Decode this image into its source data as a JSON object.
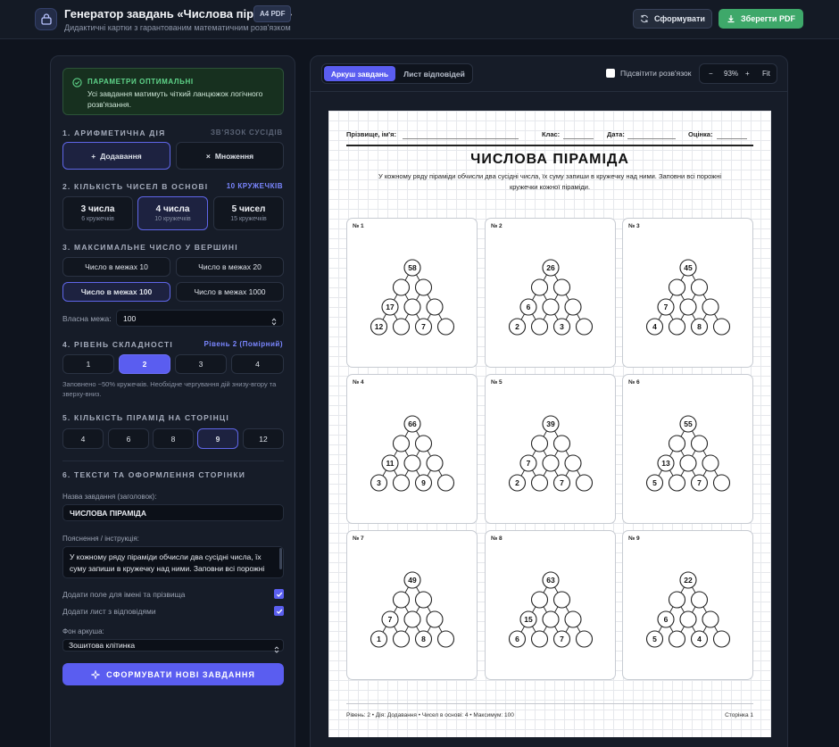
{
  "header": {
    "title": "Генератор завдань «Числова піраміда»",
    "badge": "A4 PDF",
    "subtitle": "Дидактичні картки з гарантованим математичним розв'язком",
    "generate_label": "Сформувати",
    "save_pdf_label": "Зберегти PDF"
  },
  "status": {
    "title": "ПАРАМЕТРИ ОПТИМАЛЬНІ",
    "text": "Усі завдання матимуть чіткий ланцюжок логічного розв'язання."
  },
  "operation": {
    "heading": "1. АРИФМЕТИЧНА ДІЯ",
    "side_label": "ЗВ'ЯЗОК СУСІДІВ",
    "options": [
      {
        "label": "Додавання",
        "symbol": "+",
        "selected": true
      },
      {
        "label": "Множення",
        "symbol": "×",
        "selected": false
      }
    ]
  },
  "base_count": {
    "heading": "2. КІЛЬКІСТЬ ЧИСЕЛ В ОСНОВІ",
    "side_label": "10 КРУЖЕЧКІВ",
    "options": [
      {
        "title": "3 числа",
        "sub": "6 кружечків",
        "selected": false
      },
      {
        "title": "4 числа",
        "sub": "10 кружечків",
        "selected": true
      },
      {
        "title": "5 чисел",
        "sub": "15 кружечків",
        "selected": false
      }
    ]
  },
  "max_top": {
    "heading": "3. МАКСИМАЛЬНЕ ЧИСЛО У ВЕРШИНІ",
    "options": [
      {
        "label": "Число в межах 10",
        "selected": false
      },
      {
        "label": "Число в межах 20",
        "selected": false
      },
      {
        "label": "Число в межах 100",
        "selected": true
      },
      {
        "label": "Число в межах 1000",
        "selected": false
      }
    ],
    "custom_label": "Власна межа:",
    "custom_value": "100"
  },
  "difficulty": {
    "heading": "4. РІВЕНЬ СКЛАДНОСТІ",
    "side_label": "Рівень 2 (Помірний)",
    "options": [
      {
        "label": "1",
        "selected": false
      },
      {
        "label": "2",
        "selected": true
      },
      {
        "label": "3",
        "selected": false
      },
      {
        "label": "4",
        "selected": false
      }
    ],
    "hint": "Заповнено ~50% кружечків. Необхідне чергування дій знизу-вгору та зверху-вниз."
  },
  "per_page": {
    "heading": "5. КІЛЬКІСТЬ ПІРАМІД НА СТОРІНЦІ",
    "options": [
      {
        "label": "4",
        "selected": false
      },
      {
        "label": "6",
        "selected": false
      },
      {
        "label": "8",
        "selected": false
      },
      {
        "label": "9",
        "selected": true
      },
      {
        "label": "12",
        "selected": false
      }
    ]
  },
  "texts": {
    "heading": "6. ТЕКСТИ ТА ОФОРМЛЕННЯ СТОРІНКИ",
    "title_label": "Назва завдання (заголовок):",
    "title_value": "ЧИСЛОВА ПІРАМІДА",
    "instr_label": "Пояснення / інструкція:",
    "instr_value": "У кожному ряду піраміди обчисли два сусідні числа, їх суму запиши в кружечку над ними. Заповни всі порожні кружечки кожної піраміди.",
    "name_field_label": "Додати поле для імені та прізвища",
    "answers_label": "Додати лист з відповідями",
    "bg_label": "Фон аркуша:",
    "bg_value": "Зошитова клітинка",
    "submit_label": "СФОРМУВАТИ НОВІ ЗАВДАННЯ"
  },
  "preview": {
    "tab_sheet": "Аркуш завдань",
    "tab_answers": "Лист відповідей",
    "highlight_label": "Підсвітити розв'язок",
    "zoom_minus": "−",
    "zoom_value": "93%",
    "zoom_plus": "+",
    "zoom_fit": "Fit"
  },
  "sheet": {
    "name_label": "Прізвище, ім'я:",
    "class_label": "Клас:",
    "date_label": "Дата:",
    "grade_label": "Оцінка:",
    "title": "ЧИСЛОВА ПІРАМІДА",
    "instruction": "У кожному ряду піраміди обчисли два сусідні числа, їх суму запиши в кружечку над ними. Заповни всі порожні кружечки кожної піраміди.",
    "footer_left": "Рівень: 2 • Дія: Додавання • Чисел в основі: 4 • Максимум: 100",
    "footer_right": "Сторінка 1",
    "pyramids": [
      {
        "num": "№ 1",
        "rows": [
          [
            "58"
          ],
          [
            "",
            ""
          ],
          [
            "17",
            "",
            ""
          ],
          [
            "12",
            "",
            "7",
            ""
          ]
        ]
      },
      {
        "num": "№ 2",
        "rows": [
          [
            "26"
          ],
          [
            "",
            ""
          ],
          [
            "6",
            "",
            ""
          ],
          [
            "2",
            "",
            "3",
            ""
          ]
        ]
      },
      {
        "num": "№ 3",
        "rows": [
          [
            "45"
          ],
          [
            "",
            ""
          ],
          [
            "7",
            "",
            ""
          ],
          [
            "4",
            "",
            "8",
            ""
          ]
        ]
      },
      {
        "num": "№ 4",
        "rows": [
          [
            "66"
          ],
          [
            "",
            ""
          ],
          [
            "11",
            "",
            ""
          ],
          [
            "3",
            "",
            "9",
            ""
          ]
        ]
      },
      {
        "num": "№ 5",
        "rows": [
          [
            "39"
          ],
          [
            "",
            ""
          ],
          [
            "7",
            "",
            ""
          ],
          [
            "2",
            "",
            "7",
            ""
          ]
        ]
      },
      {
        "num": "№ 6",
        "rows": [
          [
            "55"
          ],
          [
            "",
            ""
          ],
          [
            "13",
            "",
            ""
          ],
          [
            "5",
            "",
            "7",
            ""
          ]
        ]
      },
      {
        "num": "№ 7",
        "rows": [
          [
            "49"
          ],
          [
            "",
            ""
          ],
          [
            "7",
            "",
            ""
          ],
          [
            "1",
            "",
            "8",
            ""
          ]
        ]
      },
      {
        "num": "№ 8",
        "rows": [
          [
            "63"
          ],
          [
            "",
            ""
          ],
          [
            "15",
            "",
            ""
          ],
          [
            "6",
            "",
            "7",
            ""
          ]
        ]
      },
      {
        "num": "№ 9",
        "rows": [
          [
            "22"
          ],
          [
            "",
            ""
          ],
          [
            "6",
            "",
            ""
          ],
          [
            "5",
            "",
            "4",
            ""
          ]
        ]
      }
    ]
  }
}
